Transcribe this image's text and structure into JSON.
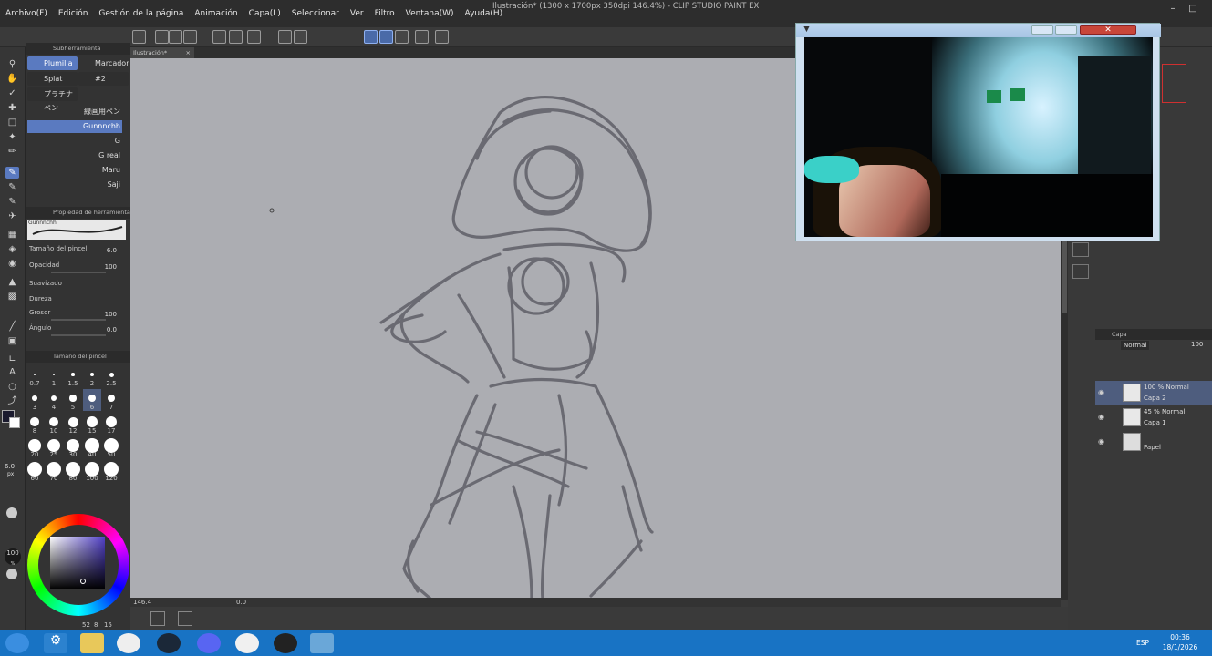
{
  "app": {
    "title": "Ilustración* (1300 x 1700px 350dpi 146.4%) - CLIP STUDIO PAINT EX",
    "menu": [
      "Archivo(F)",
      "Edición",
      "Gestión de la página",
      "Animación",
      "Capa(L)",
      "Seleccionar",
      "Ver",
      "Filtro",
      "Ventana(W)",
      "Ayuda(H)"
    ]
  },
  "subtool": {
    "header": "Subherramienta",
    "tabs": [
      "Plumilla",
      "Marcador",
      "Splat Brush",
      "#2",
      "プラチナペン"
    ],
    "brushes": [
      "線画用ペン",
      "Gunnnchh",
      "G",
      "G real",
      "Maru",
      "Saji"
    ]
  },
  "tool_property": {
    "header": "Propiedad de herramienta",
    "brush_name": "Gunnnchh",
    "rows": [
      {
        "label": "Tamaño del pincel",
        "value": "6.0"
      },
      {
        "label": "Opacidad",
        "value": "100"
      },
      {
        "label": "Suavizado",
        "value": ""
      },
      {
        "label": "Dureza",
        "value": ""
      },
      {
        "label": "Grosor",
        "value": "100"
      },
      {
        "label": "Ángulo",
        "value": "0.0"
      }
    ]
  },
  "brush_size": {
    "header": "Tamaño del pincel",
    "sizes": [
      "0.7",
      "1",
      "1.5",
      "2",
      "2.5",
      "3",
      "4",
      "5",
      "6",
      "7",
      "8",
      "10",
      "12",
      "15",
      "17",
      "20",
      "25",
      "30",
      "40",
      "50",
      "60",
      "70",
      "80",
      "100",
      "120"
    ],
    "selected": "6"
  },
  "left_indicators": {
    "size": "6.0",
    "size_unit": "px",
    "opacity": "100",
    "opacity_unit": "%"
  },
  "color": {
    "primary": "#1a1a2e",
    "secondary": "#ffffff",
    "hue": "#5241c8",
    "bottom_values": [
      "52",
      "8",
      "15"
    ]
  },
  "canvas": {
    "tab": "Ilustración*",
    "zoom": "146.4",
    "angle": "0.0",
    "background": "#acadb2",
    "stroke_color": "#6a6a72"
  },
  "layers": {
    "header": "Capa",
    "blend_mode": "Normal",
    "opacity": "100",
    "items": [
      {
        "mode": "100 % Normal",
        "name": "Capa 2",
        "selected": true
      },
      {
        "mode": "45 % Normal",
        "name": "Capa 1",
        "selected": false
      },
      {
        "mode": "",
        "name": "Papel",
        "selected": false
      }
    ]
  },
  "webcam": {
    "window": "webcam preview"
  },
  "taskbar": {
    "apps": [
      "start",
      "settings",
      "file-explorer",
      "chrome",
      "steam",
      "discord",
      "app-loop",
      "app-record",
      "app-window"
    ],
    "lang": "ESP",
    "time": "00:36",
    "date": "18/1/2026"
  }
}
